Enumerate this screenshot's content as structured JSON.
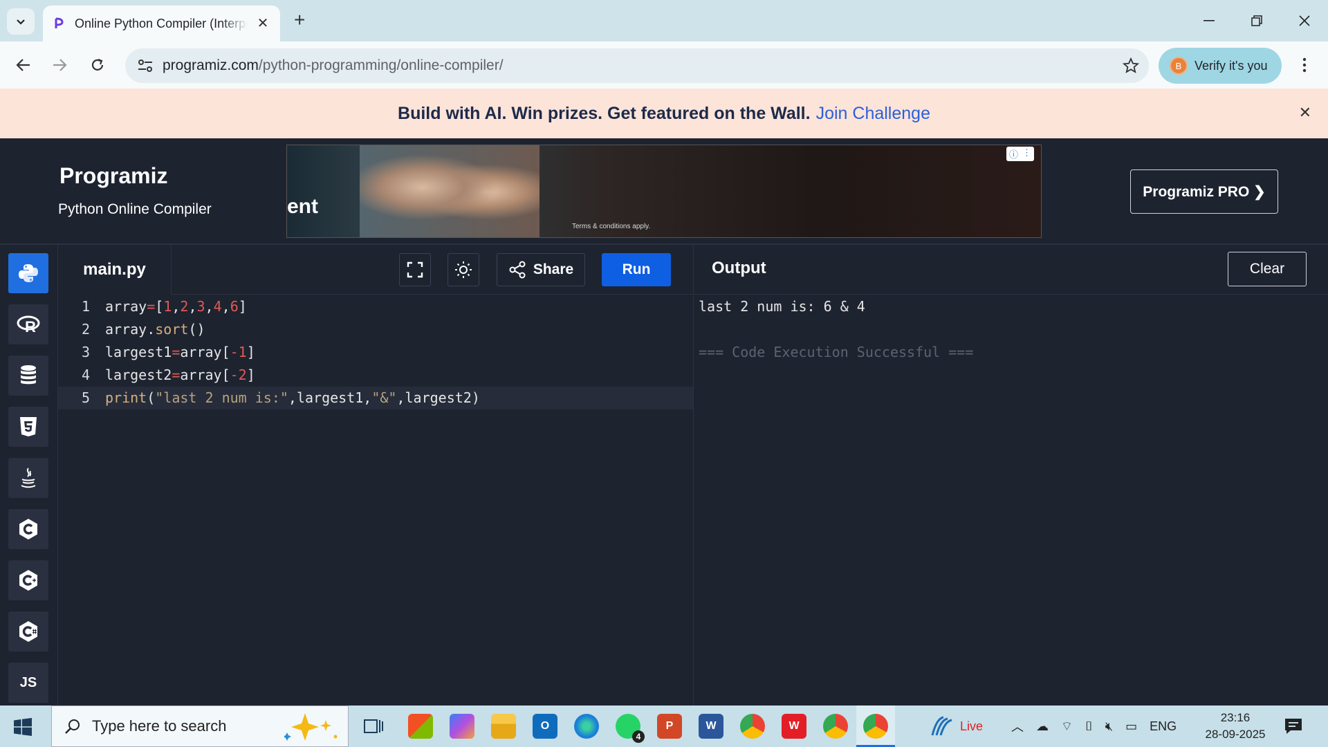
{
  "browser": {
    "tab_title": "Online Python Compiler (Interpreter)",
    "url_host": "programiz.com",
    "url_path": "/python-programming/online-compiler/",
    "verify_label": "Verify it's you",
    "avatar_letter": "B"
  },
  "banner": {
    "text": "Build with AI. Win prizes. Get featured on the Wall.",
    "link": "Join Challenge"
  },
  "header": {
    "logo": "Programiz",
    "subtitle": "Python Online Compiler",
    "ad_text": "ent",
    "ad_terms": "Terms & conditions apply.",
    "pro_button": "Programiz PRO ❯"
  },
  "sidebar": {
    "items": [
      {
        "name": "python",
        "label": ""
      },
      {
        "name": "r",
        "label": "R"
      },
      {
        "name": "sql",
        "label": ""
      },
      {
        "name": "html",
        "label": "5"
      },
      {
        "name": "java",
        "label": ""
      },
      {
        "name": "c",
        "label": "C"
      },
      {
        "name": "cpp",
        "label": "C"
      },
      {
        "name": "csharp",
        "label": "C"
      },
      {
        "name": "js",
        "label": "JS"
      }
    ]
  },
  "editor": {
    "filename": "main.py",
    "share_label": "Share",
    "run_label": "Run",
    "line_numbers": [
      "1",
      "2",
      "3",
      "4",
      "5"
    ]
  },
  "output": {
    "title": "Output",
    "clear_label": "Clear",
    "lines": [
      "last 2 num is: 6 & 4",
      "",
      "=== Code Execution Successful ==="
    ]
  },
  "taskbar": {
    "search_placeholder": "Type here to search",
    "weather": "Live",
    "language": "ENG",
    "time": "23:16",
    "date": "28-09-2025",
    "whatsapp_badge": "4"
  },
  "colors": {
    "run_button": "#0f5fe3",
    "editor_bg": "#1e2330",
    "banner_bg": "#fde4d9"
  }
}
